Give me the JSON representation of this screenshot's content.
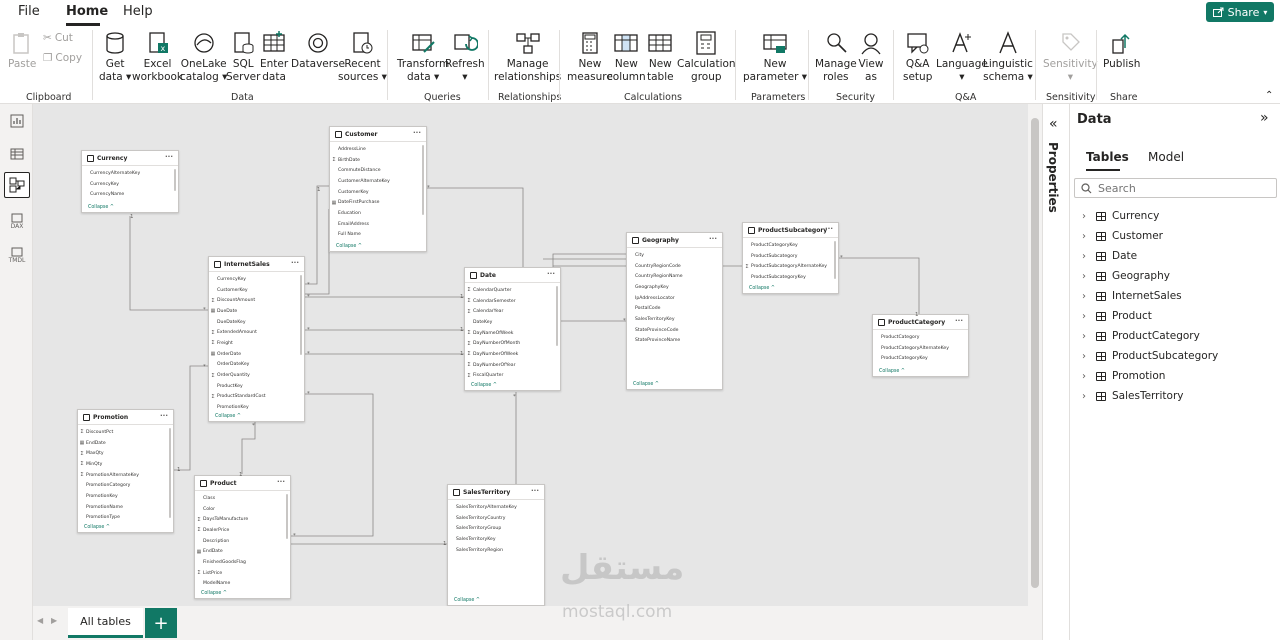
{
  "menu": {
    "file": "File",
    "home": "Home",
    "help": "Help",
    "share": "Share"
  },
  "ribbon": {
    "clipboard": {
      "paste": "Paste",
      "cut": "Cut",
      "copy": "Copy",
      "group": "Clipboard"
    },
    "data": {
      "get_data": [
        "Get",
        "data"
      ],
      "excel": [
        "Excel",
        "workbook"
      ],
      "onelake": [
        "OneLake",
        "catalog"
      ],
      "sql": [
        "SQL",
        "Server"
      ],
      "enter": [
        "Enter",
        "data"
      ],
      "dataverse": "Dataverse",
      "recent": [
        "Recent",
        "sources"
      ],
      "group": "Data"
    },
    "queries": {
      "transform": [
        "Transform",
        "data"
      ],
      "refresh": "Refresh",
      "group": "Queries"
    },
    "relationships": {
      "manage": [
        "Manage",
        "relationships"
      ],
      "group": "Relationships"
    },
    "calculations": {
      "measure": [
        "New",
        "measure"
      ],
      "column": [
        "New",
        "column"
      ],
      "table": [
        "New",
        "table"
      ],
      "calc_group": [
        "Calculation",
        "group"
      ],
      "group": "Calculations"
    },
    "parameters": {
      "new_param": [
        "New",
        "parameter"
      ],
      "group": "Parameters"
    },
    "security": {
      "manage_roles": [
        "Manage",
        "roles"
      ],
      "view_as": [
        "View",
        "as"
      ],
      "group": "Security"
    },
    "qa": {
      "qa_setup": [
        "Q&A",
        "setup"
      ],
      "language": "Language",
      "linguistic": [
        "Linguistic",
        "schema"
      ],
      "group": "Q&A"
    },
    "sensitivity": {
      "label": "Sensitivity",
      "group": "Sensitivity"
    },
    "share": {
      "publish": "Publish",
      "group": "Share"
    }
  },
  "rail": {
    "dax": "DAX",
    "tmdl": "TMDL"
  },
  "tables": {
    "currency": {
      "name": "Currency",
      "fields": [
        "CurrencyAlternateKey",
        "CurrencyKey",
        "CurrencyName"
      ]
    },
    "customer": {
      "name": "Customer",
      "fields": [
        "AddressLine",
        "BirthDate",
        "CommuteDistance",
        "CustomerAlternateKey",
        "CustomerKey",
        "DateFirstPurchase",
        "Education",
        "EmailAddress",
        "Full Name"
      ]
    },
    "internetsales": {
      "name": "InternetSales",
      "fields": [
        "CurrencyKey",
        "CustomerKey",
        "DiscountAmount",
        "DueDate",
        "DueDateKey",
        "ExtendedAmount",
        "Freight",
        "OrderDate",
        "OrderDateKey",
        "OrderQuantity",
        "ProductKey",
        "ProductStandardCost",
        "PromotionKey"
      ]
    },
    "date": {
      "name": "Date",
      "fields": [
        "CalendarQuarter",
        "CalendarSemester",
        "CalendarYear",
        "DateKey",
        "DayNameOfWeek",
        "DayNumberOfMonth",
        "DayNumberOfWeek",
        "DayNumberOfYear",
        "FiscalQuarter"
      ]
    },
    "geography": {
      "name": "Geography",
      "fields": [
        "City",
        "CountryRegionCode",
        "CountryRegionName",
        "GeographyKey",
        "IpAddressLocator",
        "PostalCode",
        "SalesTerritoryKey",
        "StateProvinceCode",
        "StateProvinceName"
      ]
    },
    "productsubcategory": {
      "name": "ProductSubcategory",
      "fields": [
        "ProductCategoryKey",
        "ProductSubcategory",
        "ProductSubcategoryAlternateKey",
        "ProductSubcategoryKey"
      ]
    },
    "productcategory": {
      "name": "ProductCategory",
      "fields": [
        "ProductCategory",
        "ProductCategoryAlternateKey",
        "ProductCategoryKey"
      ]
    },
    "promotion": {
      "name": "Promotion",
      "fields": [
        "DiscountPct",
        "EndDate",
        "MaxQty",
        "MinQty",
        "PromotionAlternateKey",
        "PromotionCategory",
        "PromotionKey",
        "PromotionName",
        "PromotionType"
      ]
    },
    "product": {
      "name": "Product",
      "fields": [
        "Class",
        "Color",
        "DaysToManufacture",
        "DealerPrice",
        "Description",
        "EndDate",
        "FinishedGoodsFlag",
        "ListPrice",
        "ModelName"
      ]
    },
    "salesterritory": {
      "name": "SalesTerritory",
      "fields": [
        "SalesTerritoryAlternateKey",
        "SalesTerritoryCountry",
        "SalesTerritoryGroup",
        "SalesTerritoryKey",
        "SalesTerritoryRegion"
      ]
    },
    "collapse": "Collapse ^"
  },
  "bottom": {
    "all_tables": "All tables",
    "add": "+"
  },
  "watermark": {
    "arabic": "مستقل",
    "latin": "mostaql.com"
  },
  "props": {
    "label": "Properties"
  },
  "datapane": {
    "title": "Data",
    "tab_tables": "Tables",
    "tab_model": "Model",
    "search_placeholder": "Search",
    "items": [
      "Currency",
      "Customer",
      "Date",
      "Geography",
      "InternetSales",
      "Product",
      "ProductCategory",
      "ProductSubcategory",
      "Promotion",
      "SalesTerritory"
    ]
  },
  "colors": {
    "accent": "#117865",
    "canvas": "#e6e6e6"
  }
}
